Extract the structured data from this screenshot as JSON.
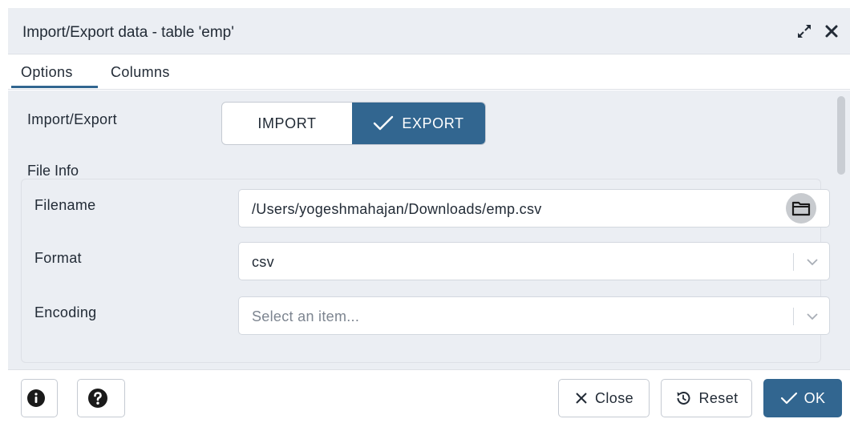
{
  "dialog": {
    "title": "Import/Export data - table 'emp'"
  },
  "tabs": [
    {
      "label": "Options",
      "active": true
    },
    {
      "label": "Columns",
      "active": false
    }
  ],
  "import_export": {
    "label": "Import/Export",
    "options": [
      "IMPORT",
      "EXPORT"
    ],
    "selected": "EXPORT"
  },
  "file_info": {
    "legend": "File Info",
    "filename_label": "Filename",
    "filename_value": "/Users/yogeshmahajan/Downloads/emp.csv",
    "format_label": "Format",
    "format_value": "csv",
    "encoding_label": "Encoding",
    "encoding_placeholder": "Select an item..."
  },
  "footer": {
    "close_label": "Close",
    "reset_label": "Reset",
    "ok_label": "OK"
  },
  "icons": {
    "expand": "expand-icon",
    "close": "close-icon",
    "folder": "folder-icon",
    "info": "info-icon",
    "help": "help-icon",
    "checkmark": "checkmark-icon",
    "reset": "reset-icon",
    "chevron": "chevron-down-icon"
  },
  "colors": {
    "accent": "#326690",
    "panel_background": "#ebeef3",
    "text": "#222b36"
  }
}
